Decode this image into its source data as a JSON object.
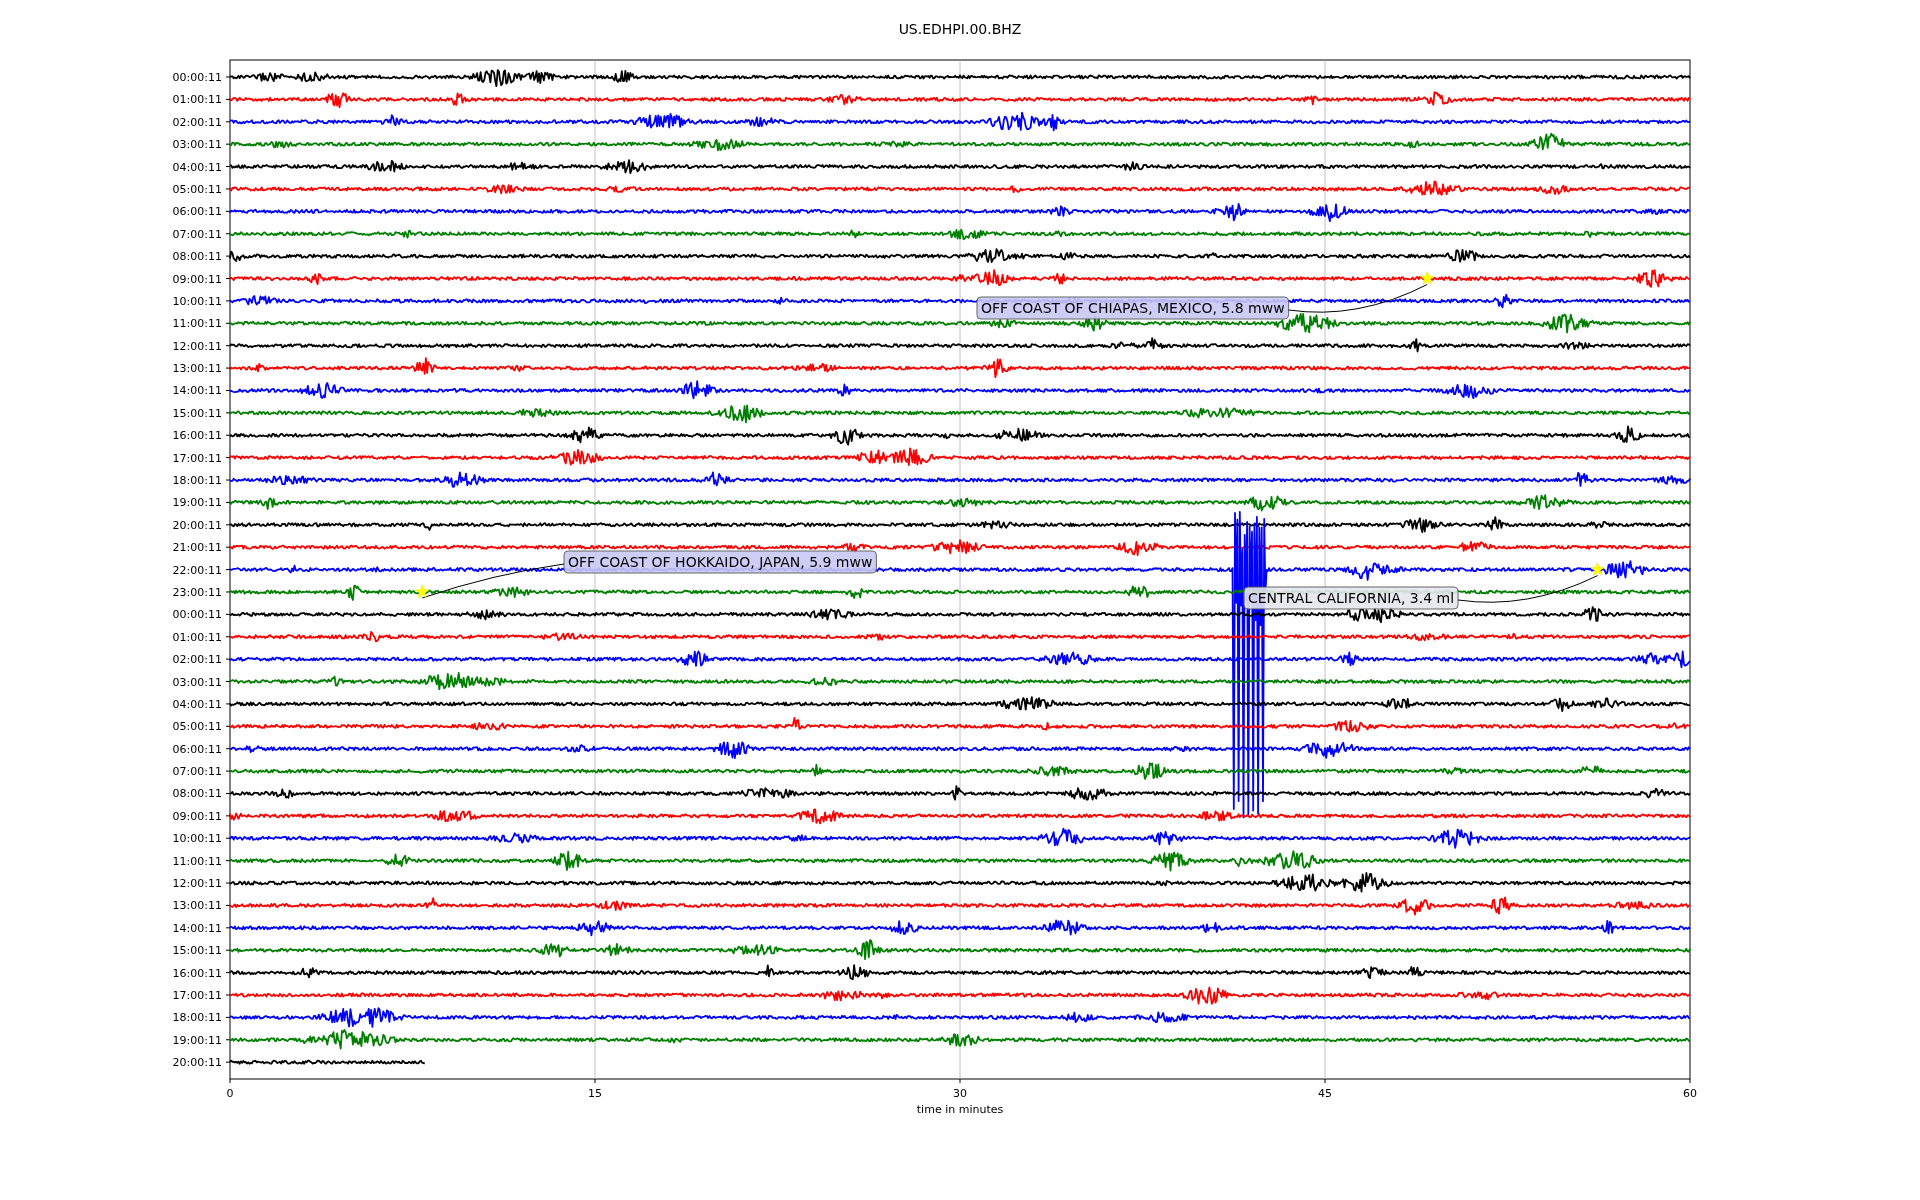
{
  "title": "US.EDHPI.00.BHZ",
  "plot": {
    "xlabel": "time in minutes",
    "xticks": [
      "0",
      "15",
      "30",
      "45",
      "60"
    ],
    "rows": [
      {
        "label": "00:00:11",
        "color": "#000000"
      },
      {
        "label": "01:00:11",
        "color": "#ff0000"
      },
      {
        "label": "02:00:11",
        "color": "#0000ff"
      },
      {
        "label": "03:00:11",
        "color": "#008000"
      },
      {
        "label": "04:00:11",
        "color": "#000000"
      },
      {
        "label": "05:00:11",
        "color": "#ff0000"
      },
      {
        "label": "06:00:11",
        "color": "#0000ff"
      },
      {
        "label": "07:00:11",
        "color": "#008000"
      },
      {
        "label": "08:00:11",
        "color": "#000000"
      },
      {
        "label": "09:00:11",
        "color": "#ff0000"
      },
      {
        "label": "10:00:11",
        "color": "#0000ff"
      },
      {
        "label": "11:00:11",
        "color": "#008000"
      },
      {
        "label": "12:00:11",
        "color": "#000000"
      },
      {
        "label": "13:00:11",
        "color": "#ff0000"
      },
      {
        "label": "14:00:11",
        "color": "#0000ff"
      },
      {
        "label": "15:00:11",
        "color": "#008000"
      },
      {
        "label": "16:00:11",
        "color": "#000000"
      },
      {
        "label": "17:00:11",
        "color": "#ff0000"
      },
      {
        "label": "18:00:11",
        "color": "#0000ff"
      },
      {
        "label": "19:00:11",
        "color": "#008000"
      },
      {
        "label": "20:00:11",
        "color": "#000000"
      },
      {
        "label": "21:00:11",
        "color": "#ff0000"
      },
      {
        "label": "22:00:11",
        "color": "#0000ff"
      },
      {
        "label": "23:00:11",
        "color": "#008000"
      },
      {
        "label": "00:00:11",
        "color": "#000000"
      },
      {
        "label": "01:00:11",
        "color": "#ff0000"
      },
      {
        "label": "02:00:11",
        "color": "#0000ff"
      },
      {
        "label": "03:00:11",
        "color": "#008000"
      },
      {
        "label": "04:00:11",
        "color": "#000000"
      },
      {
        "label": "05:00:11",
        "color": "#ff0000"
      },
      {
        "label": "06:00:11",
        "color": "#0000ff"
      },
      {
        "label": "07:00:11",
        "color": "#008000"
      },
      {
        "label": "08:00:11",
        "color": "#000000"
      },
      {
        "label": "09:00:11",
        "color": "#ff0000"
      },
      {
        "label": "10:00:11",
        "color": "#0000ff"
      },
      {
        "label": "11:00:11",
        "color": "#008000"
      },
      {
        "label": "12:00:11",
        "color": "#000000"
      },
      {
        "label": "13:00:11",
        "color": "#ff0000"
      },
      {
        "label": "14:00:11",
        "color": "#0000ff"
      },
      {
        "label": "15:00:11",
        "color": "#008000"
      },
      {
        "label": "16:00:11",
        "color": "#000000"
      },
      {
        "label": "17:00:11",
        "color": "#ff0000"
      },
      {
        "label": "18:00:11",
        "color": "#0000ff"
      },
      {
        "label": "19:00:11",
        "color": "#008000"
      },
      {
        "label": "20:00:11",
        "color": "#000000"
      }
    ],
    "events": [
      {
        "label": "OFF COAST OF CHIAPAS, MEXICO, 5.8 mww"
      },
      {
        "label": "OFF COAST OF HOKKAIDO, JAPAN, 5.9 mww"
      },
      {
        "label": "CENTRAL CALIFORNIA, 3.4 ml"
      }
    ]
  }
}
